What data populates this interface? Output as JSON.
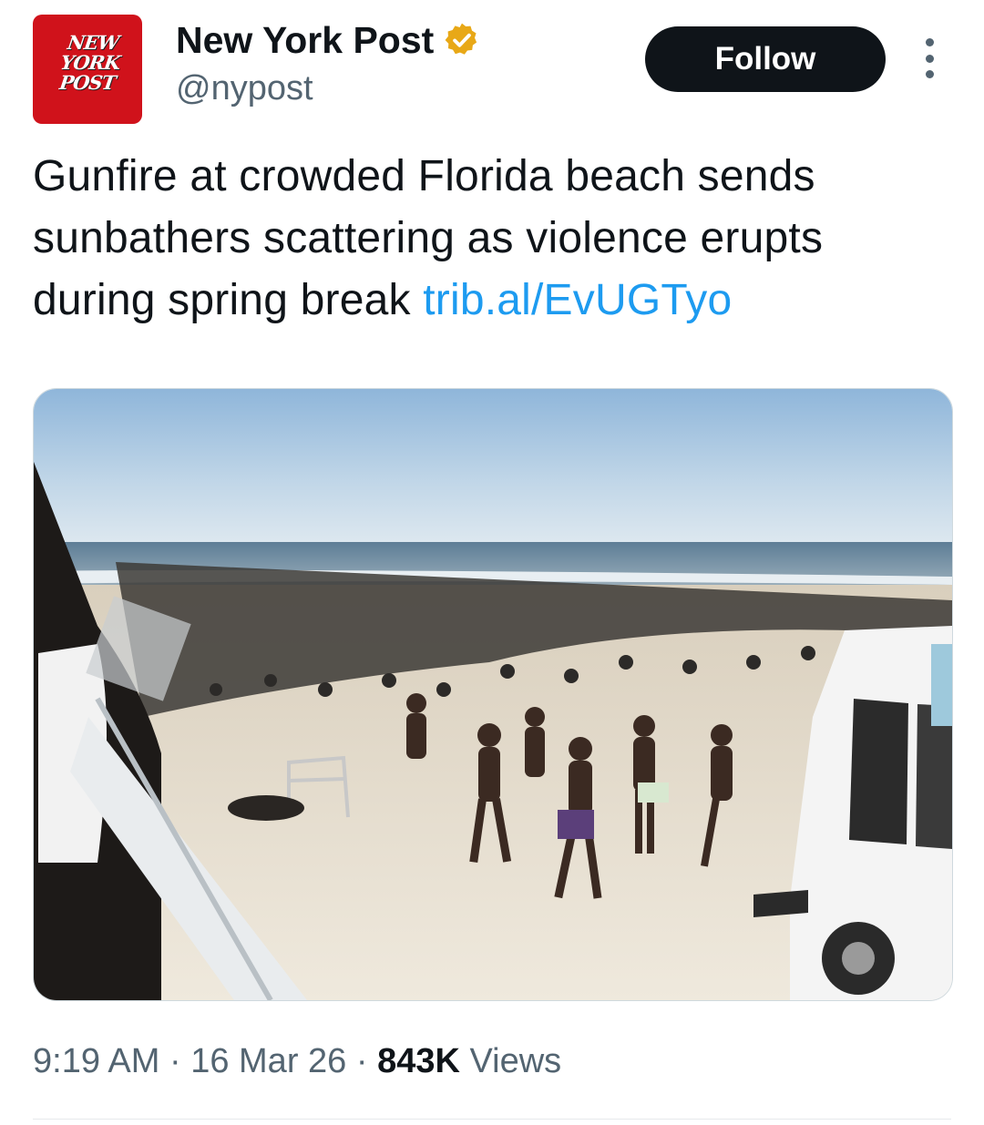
{
  "author": {
    "display_name": "New York Post",
    "handle": "@nypost",
    "avatar_text": "NEW YORK POST",
    "verified_icon": "verified-badge-icon",
    "brand_color": "#d0121b",
    "badge_color": "#e8a817"
  },
  "actions": {
    "follow_label": "Follow",
    "more_icon": "more-options-icon"
  },
  "tweet": {
    "text": "Gunfire at crowded Florida beach sends sunbathers scattering as violence erupts during spring break ",
    "link": "trib.al/EvUGTyo"
  },
  "media": {
    "type": "photo",
    "icon": "beach-photo"
  },
  "meta": {
    "time": "9:19 AM",
    "date": "16 Mar 26",
    "views_count": "843K",
    "views_label": "Views"
  },
  "colors": {
    "text": "#0f1419",
    "secondary": "#536471",
    "link": "#1d9bf0"
  }
}
